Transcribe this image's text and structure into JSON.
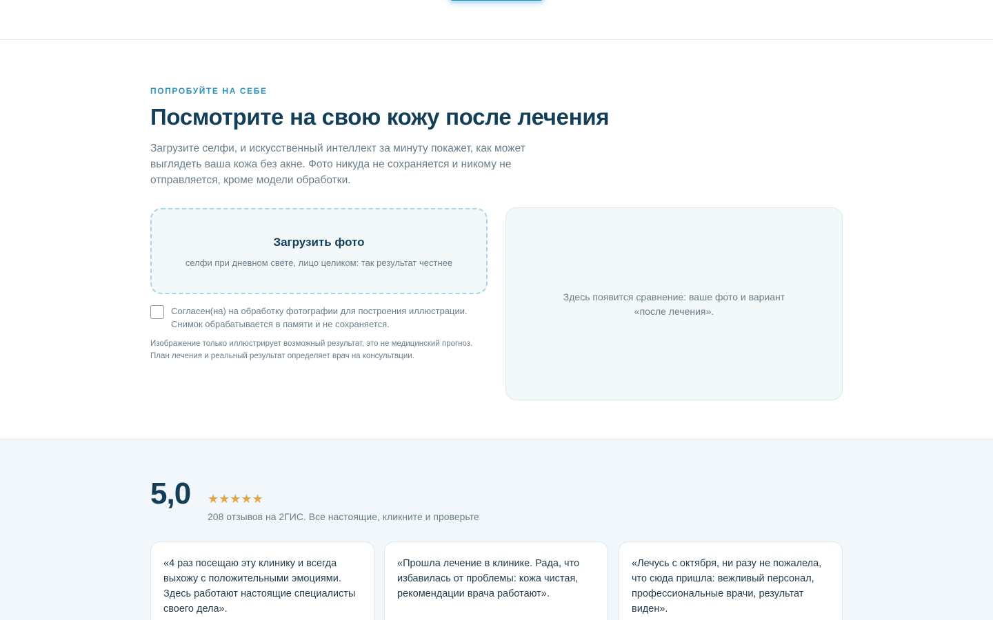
{
  "try_section": {
    "eyebrow": "ПОПРОБУЙТЕ НА СЕБЕ",
    "title": "Посмотрите на свою кожу после лечения",
    "lead": "Загрузите селфи, и искусственный интеллект за минуту покажет, как может выглядеть ваша кожа без акне. Фото никуда не сохраняется и никому не отправляется, кроме модели обработки.",
    "upload": {
      "title": "Загрузить фото",
      "hint": "селфи при дневном свете, лицо целиком: так результат честнее"
    },
    "consent": {
      "checked": false,
      "text": "Согласен(на) на обработку фотографии для построения иллюстрации. Снимок обрабатывается в памяти и не сохраняется."
    },
    "disclaimer": "Изображение только иллюстрирует возможный результат, это не медицинский прогноз. План лечения и реальный результат определяет врач на консультации.",
    "preview_placeholder": "Здесь появится сравнение: ваше фото и вариант «после лечения»."
  },
  "reviews": {
    "rating": "5,0",
    "stars": "★★★★★",
    "rating_stars_count": 5,
    "note": "208 отзывов на 2ГИС. Все настоящие, кликните и проверьте",
    "items": [
      {
        "text": "«4 раз посещаю эту клинику и всегда выхожу с положительными эмоциями. Здесь работают настоящие специалисты своего дела»."
      },
      {
        "text": "«Прошла лечение в клинике. Рада, что избавилась от проблемы: кожа чистая, рекомендации врача работают»."
      },
      {
        "text": "«Лечусь с октября, ни разу не пожалела, что сюда пришла: вежливый персонал, профессиональные врачи, результат виден»."
      }
    ]
  },
  "colors": {
    "accent": "#2b92be",
    "heading": "#123f57",
    "muted_text": "#6a7d88",
    "star": "#e5a64a",
    "panel_bg": "#f3f8fb",
    "reviews_bg": "#f1f7fb"
  }
}
